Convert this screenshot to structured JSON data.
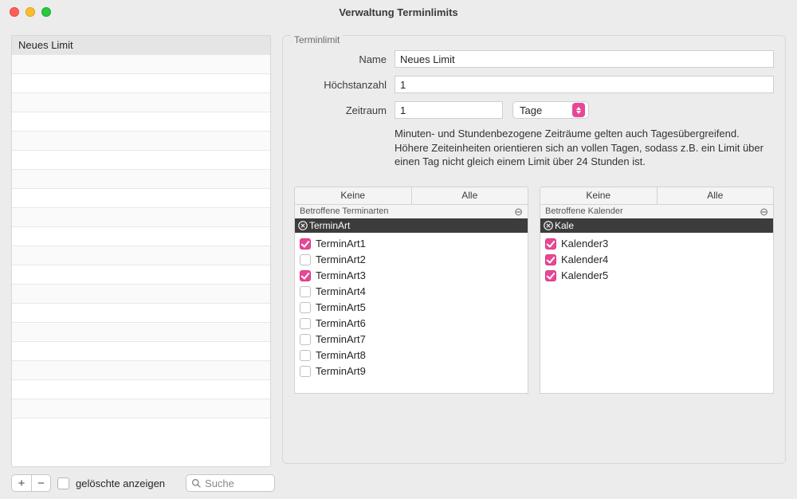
{
  "window": {
    "title": "Verwaltung Terminlimits"
  },
  "sidebar": {
    "items": [
      {
        "label": "Neues Limit",
        "selected": true
      }
    ],
    "blankRowCount": 20
  },
  "toolbar": {
    "addLabel": "+",
    "removeLabel": "−",
    "showDeletedLabel": "gelöschte anzeigen",
    "searchPlaceholder": "Suche"
  },
  "group": {
    "title": "Terminlimit"
  },
  "form": {
    "nameLabel": "Name",
    "nameValue": "Neues Limit",
    "maxLabel": "Höchstanzahl",
    "maxValue": "1",
    "periodLabel": "Zeitraum",
    "periodValue": "1",
    "unitSelected": "Tage",
    "help": "Minuten- und Stundenbezogene Zeiträume gelten auch Tagesübergreifend. Höhere Zeiteinheiten orientieren sich an vollen Tagen, sodass z.B. ein Limit über einen Tag nicht gleich einem Limit über 24 Stunden ist."
  },
  "tabs": {
    "none": "Keine",
    "all": "Alle"
  },
  "left": {
    "section": "Betroffene Terminarten",
    "filter": "TerminArt",
    "items": [
      {
        "label": "TerminArt1",
        "checked": true
      },
      {
        "label": "TerminArt2",
        "checked": false
      },
      {
        "label": "TerminArt3",
        "checked": true
      },
      {
        "label": "TerminArt4",
        "checked": false
      },
      {
        "label": "TerminArt5",
        "checked": false
      },
      {
        "label": "TerminArt6",
        "checked": false
      },
      {
        "label": "TerminArt7",
        "checked": false
      },
      {
        "label": "TerminArt8",
        "checked": false
      },
      {
        "label": "TerminArt9",
        "checked": false
      }
    ]
  },
  "right": {
    "section": "Betroffene Kalender",
    "filter": "Kale",
    "items": [
      {
        "label": "Kalender3",
        "checked": true
      },
      {
        "label": "Kalender4",
        "checked": true
      },
      {
        "label": "Kalender5",
        "checked": true
      }
    ]
  }
}
